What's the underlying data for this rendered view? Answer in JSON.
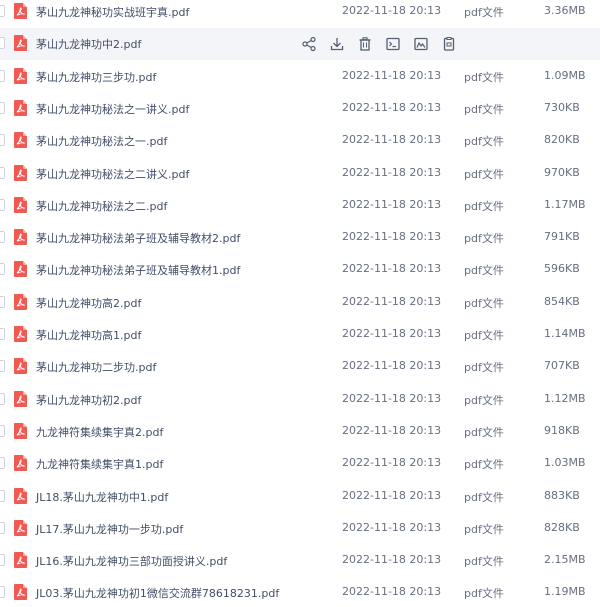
{
  "colors": {
    "pdf_icon": "#f05a53",
    "hover_row": "#f4f5f9",
    "text": "#424e67",
    "meta_text": "#666f80"
  },
  "row_actions": [
    {
      "icon": "share-icon"
    },
    {
      "icon": "download-icon"
    },
    {
      "icon": "delete-icon"
    },
    {
      "icon": "terminal-icon"
    },
    {
      "icon": "image-icon"
    },
    {
      "icon": "clipboard-icon"
    }
  ],
  "files": [
    {
      "name": "茅山九龙神秘功实战班宇真.pdf",
      "date": "2022-11-18 20:13",
      "type": "pdf文件",
      "size": "3.36MB"
    },
    {
      "name": "茅山九龙神功中2.pdf",
      "date": "",
      "type": "",
      "size": ""
    },
    {
      "name": "茅山九龙神功三步功.pdf",
      "date": "2022-11-18 20:13",
      "type": "pdf文件",
      "size": "1.09MB"
    },
    {
      "name": "茅山九龙神功秘法之一讲义.pdf",
      "date": "2022-11-18 20:13",
      "type": "pdf文件",
      "size": "730KB"
    },
    {
      "name": "茅山九龙神功秘法之一.pdf",
      "date": "2022-11-18 20:13",
      "type": "pdf文件",
      "size": "820KB"
    },
    {
      "name": "茅山九龙神功秘法之二讲义.pdf",
      "date": "2022-11-18 20:13",
      "type": "pdf文件",
      "size": "970KB"
    },
    {
      "name": "茅山九龙神功秘法之二.pdf",
      "date": "2022-11-18 20:13",
      "type": "pdf文件",
      "size": "1.17MB"
    },
    {
      "name": "茅山九龙神功秘法弟子班及辅导教材2.pdf",
      "date": "2022-11-18 20:13",
      "type": "pdf文件",
      "size": "791KB"
    },
    {
      "name": "茅山九龙神功秘法弟子班及辅导教材1.pdf",
      "date": "2022-11-18 20:13",
      "type": "pdf文件",
      "size": "596KB"
    },
    {
      "name": "茅山九龙神功高2.pdf",
      "date": "2022-11-18 20:13",
      "type": "pdf文件",
      "size": "854KB"
    },
    {
      "name": "茅山九龙神功高1.pdf",
      "date": "2022-11-18 20:13",
      "type": "pdf文件",
      "size": "1.14MB"
    },
    {
      "name": "茅山九龙神功二步功.pdf",
      "date": "2022-11-18 20:13",
      "type": "pdf文件",
      "size": "707KB"
    },
    {
      "name": "茅山九龙神功初2.pdf",
      "date": "2022-11-18 20:13",
      "type": "pdf文件",
      "size": "1.12MB"
    },
    {
      "name": "九龙神符集续集宇真2.pdf",
      "date": "2022-11-18 20:13",
      "type": "pdf文件",
      "size": "918KB"
    },
    {
      "name": "九龙神符集续集宇真1.pdf",
      "date": "2022-11-18 20:13",
      "type": "pdf文件",
      "size": "1.03MB"
    },
    {
      "name": "JL18.茅山九龙神功中1.pdf",
      "date": "2022-11-18 20:13",
      "type": "pdf文件",
      "size": "883KB"
    },
    {
      "name": "JL17.茅山九龙神功一步功.pdf",
      "date": "2022-11-18 20:13",
      "type": "pdf文件",
      "size": "828KB"
    },
    {
      "name": "JL16.茅山九龙神功三部功面授讲义.pdf",
      "date": "2022-11-18 20:13",
      "type": "pdf文件",
      "size": "2.15MB"
    },
    {
      "name": "JL03.茅山九龙神功初1微信交流群78618231.pdf",
      "date": "2022-11-18 20:13",
      "type": "pdf文件",
      "size": "1.19MB"
    }
  ]
}
